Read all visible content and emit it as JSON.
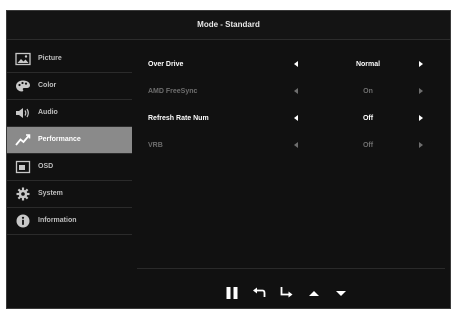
{
  "title": "Mode - Standard",
  "sidebar": {
    "items": [
      {
        "label": "Picture",
        "icon": "picture-icon",
        "active": false
      },
      {
        "label": "Color",
        "icon": "palette-icon",
        "active": false
      },
      {
        "label": "Audio",
        "icon": "speaker-icon",
        "active": false
      },
      {
        "label": "Performance",
        "icon": "performance-graph-icon",
        "active": true
      },
      {
        "label": "OSD",
        "icon": "osd-icon",
        "active": false
      },
      {
        "label": "System",
        "icon": "gear-icon",
        "active": false
      },
      {
        "label": "Information",
        "icon": "info-icon",
        "active": false
      }
    ]
  },
  "settings": [
    {
      "label": "Over Drive",
      "value": "Normal",
      "enabled": true
    },
    {
      "label": "AMD FreeSync",
      "value": "On",
      "enabled": false
    },
    {
      "label": "Refresh Rate Num",
      "value": "Off",
      "enabled": true
    },
    {
      "label": "VRB",
      "value": "Off",
      "enabled": false
    }
  ],
  "keys": [
    "pause-icon",
    "back-return-icon",
    "enter-icon",
    "up-triangle-icon",
    "down-triangle-icon"
  ],
  "colors": {
    "background": "#111111",
    "active_item": "#8a8a8a",
    "text": "#ffffff",
    "disabled_text": "#6e6e6e"
  }
}
